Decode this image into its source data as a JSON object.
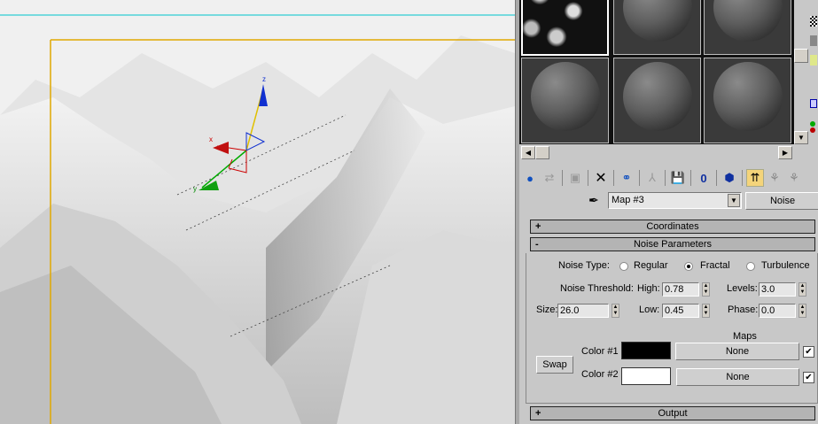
{
  "viewport": {
    "gizmo_axes": [
      "x",
      "y",
      "z"
    ]
  },
  "material_editor": {
    "map_name": "Map #3",
    "map_type": "Noise",
    "rollouts": {
      "coordinates": "Coordinates",
      "noise_parameters": "Noise Parameters",
      "output": "Output"
    },
    "expand_sign": "+",
    "collapse_sign": "-",
    "noise_type": {
      "label": "Noise Type:",
      "options": [
        "Regular",
        "Fractal",
        "Turbulence"
      ],
      "selected": "Fractal"
    },
    "noise_threshold_label": "Noise Threshold:",
    "high": {
      "label": "High:",
      "value": "0.78"
    },
    "low": {
      "label": "Low:",
      "value": "0.45"
    },
    "levels": {
      "label": "Levels:",
      "value": "3.0"
    },
    "phase": {
      "label": "Phase:",
      "value": "0.0"
    },
    "size": {
      "label": "Size:",
      "value": "26.0"
    },
    "maps_label": "Maps",
    "swap_label": "Swap",
    "color1": {
      "label": "Color #1",
      "color": "#000000",
      "map": "None",
      "enabled": true
    },
    "color2": {
      "label": "Color #2",
      "color": "#ffffff",
      "map": "None",
      "enabled": true
    }
  },
  "colors": {
    "viewport_border": "#4fd3d8",
    "safe_frame": "#e0a800",
    "highlight": "#f4d47a"
  }
}
